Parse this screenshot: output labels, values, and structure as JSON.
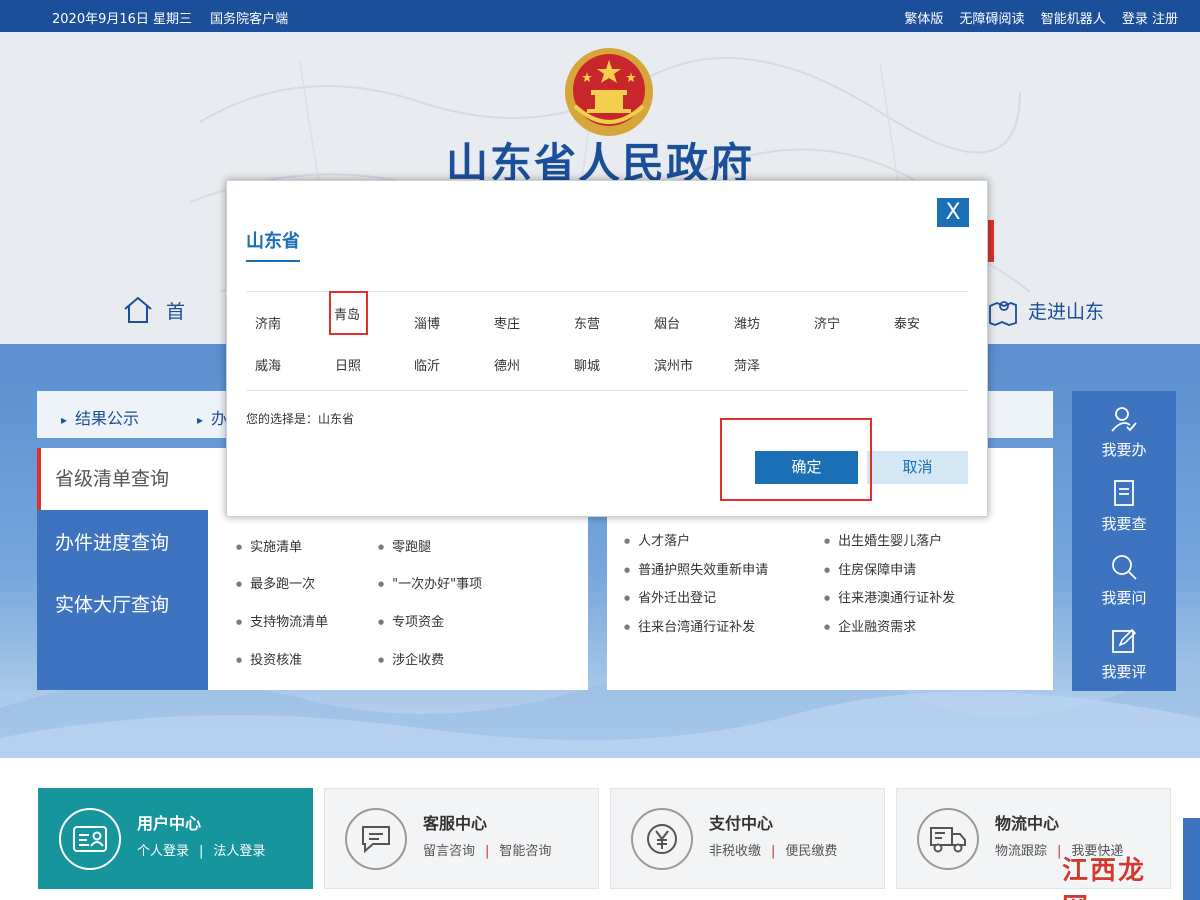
{
  "topbar": {
    "date": "2020年9月16日 星期三",
    "client": "国务院客户端",
    "links": [
      "繁体版",
      "无障碍阅读",
      "智能机器人",
      "登录 注册"
    ]
  },
  "header": {
    "title": "山东省人民政府",
    "nav_home": "首 页",
    "nav_shandong": "走进山东"
  },
  "tabs": [
    "结果公示",
    "办"
  ],
  "left_menu": [
    "省级清单查询",
    "办件进度查询",
    "实体大厅查询"
  ],
  "panel1": {
    "col1": [
      "实施清单",
      "最多跑一次",
      "支持物流清单",
      "投资核准"
    ],
    "col2": [
      "零跑腿",
      "\"一次办好\"事项",
      "专项资金",
      "涉企收费"
    ]
  },
  "panel2": {
    "col1": [
      "人才落户",
      "普通护照失效重新申请",
      "省外迁出登记",
      "往来台湾通行证补发"
    ],
    "col2": [
      "出生婚生婴儿落户",
      "住房保障申请",
      "往来港澳通行证补发",
      "企业融资需求"
    ]
  },
  "right_nav": [
    "我要办",
    "我要查",
    "我要问",
    "我要评"
  ],
  "services": [
    {
      "title": "用户中心",
      "links": [
        "个人登录",
        "法人登录"
      ],
      "icon": "id-card-icon"
    },
    {
      "title": "客服中心",
      "links": [
        "留言咨询",
        "智能咨询"
      ],
      "icon": "chat-bubble-icon"
    },
    {
      "title": "支付中心",
      "links": [
        "非税收缴",
        "便民缴费"
      ],
      "icon": "yen-icon"
    },
    {
      "title": "物流中心",
      "links": [
        "物流跟踪",
        "我要快递"
      ],
      "icon": "truck-icon"
    }
  ],
  "watermark": "江西龙网",
  "modal": {
    "close_label": "X",
    "province": "山东省",
    "cities_row1": [
      "济南",
      "青岛",
      "淄博",
      "枣庄",
      "东营",
      "烟台",
      "潍坊",
      "济宁",
      "泰安"
    ],
    "cities_row2": [
      "威海",
      "日照",
      "临沂",
      "德州",
      "聊城",
      "滨州市",
      "菏泽"
    ],
    "choice_text": "您的选择是：山东省",
    "confirm_label": "确定",
    "cancel_label": "取消"
  },
  "colors": {
    "topbar": "#1c4f99",
    "primary": "#3d73bf",
    "modal_button": "#1a6fb5",
    "highlight": "#e0302b",
    "teal": "#17959d"
  }
}
